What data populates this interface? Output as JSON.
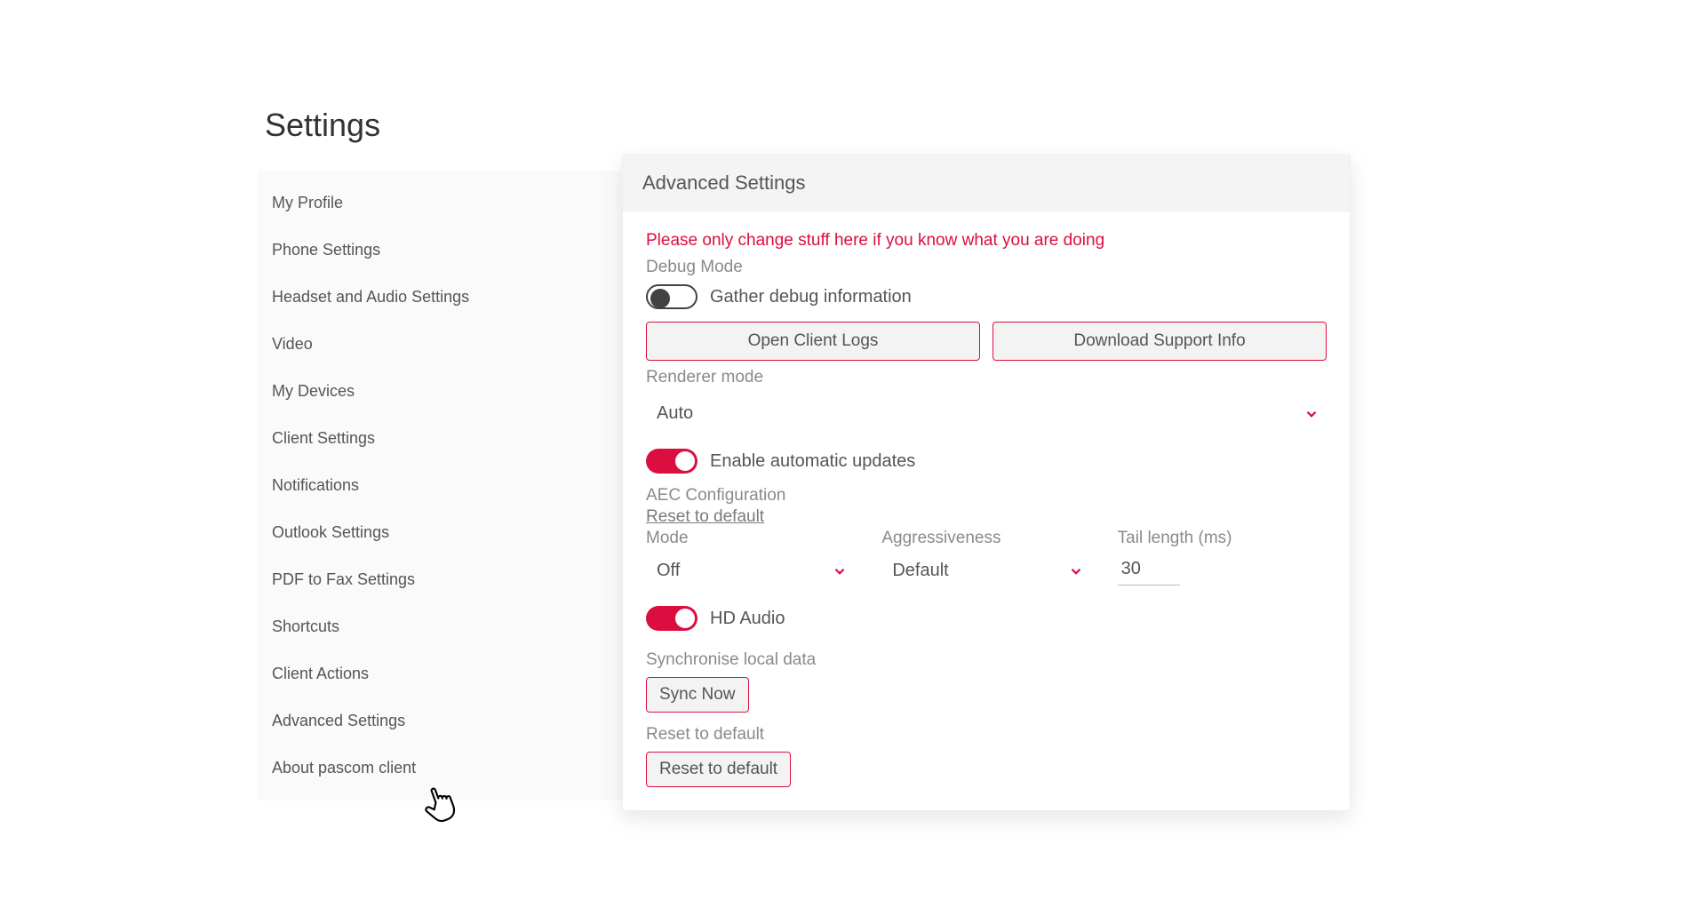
{
  "page": {
    "title": "Settings"
  },
  "sidebar": {
    "items": [
      {
        "label": "My Profile"
      },
      {
        "label": "Phone Settings"
      },
      {
        "label": "Headset and Audio Settings"
      },
      {
        "label": "Video"
      },
      {
        "label": "My Devices"
      },
      {
        "label": "Client Settings"
      },
      {
        "label": "Notifications"
      },
      {
        "label": "Outlook Settings"
      },
      {
        "label": "PDF to Fax Settings"
      },
      {
        "label": "Shortcuts"
      },
      {
        "label": "Client Actions"
      },
      {
        "label": "Advanced Settings"
      },
      {
        "label": "About pascom client"
      }
    ]
  },
  "panel": {
    "title": "Advanced Settings",
    "warning": "Please only change stuff here if you know what you are doing",
    "sections": {
      "debug": {
        "label": "Debug Mode",
        "gather_label": "Gather debug information",
        "open_logs": "Open Client Logs",
        "download_support": "Download Support Info"
      },
      "renderer": {
        "label": "Renderer mode",
        "value": "Auto"
      },
      "updates": {
        "label": "Enable automatic updates"
      },
      "aec": {
        "label": "AEC Configuration",
        "reset_link": "Reset to default",
        "mode_label": "Mode",
        "mode_value": "Off",
        "aggr_label": "Aggressiveness",
        "aggr_value": "Default",
        "tail_label": "Tail length (ms)",
        "tail_value": "30"
      },
      "hd": {
        "label": "HD Audio"
      },
      "sync": {
        "label": "Synchronise local data",
        "button": "Sync Now"
      },
      "reset": {
        "label": "Reset to default",
        "button": "Reset to default"
      }
    }
  }
}
